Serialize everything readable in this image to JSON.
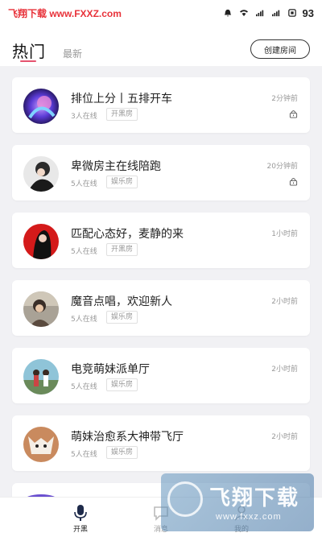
{
  "status_bar": {
    "watermark": "飞翔下载 www.FXXZ.com",
    "battery": "93"
  },
  "header": {
    "tab_hot": "热门",
    "tab_new": "最新",
    "create_button": "创建房间"
  },
  "rooms": [
    {
      "name": "排位上分丨五排开车",
      "online": "3人在线",
      "tag": "开黑房",
      "time": "2分钟前",
      "locked": true
    },
    {
      "name": "卑微房主在线陪跑",
      "online": "5人在线",
      "tag": "娱乐房",
      "time": "20分钟前",
      "locked": true
    },
    {
      "name": "匹配心态好，麦静的来",
      "online": "5人在线",
      "tag": "开黑房",
      "time": "1小时前",
      "locked": false
    },
    {
      "name": "魔音点唱，欢迎新人",
      "online": "5人在线",
      "tag": "娱乐房",
      "time": "2小时前",
      "locked": false
    },
    {
      "name": "电竞萌妹派单厅",
      "online": "5人在线",
      "tag": "娱乐房",
      "time": "2小时前",
      "locked": false
    },
    {
      "name": "萌妹治愈系大神带飞厅",
      "online": "5人在线",
      "tag": "娱乐房",
      "time": "2小时前",
      "locked": false
    }
  ],
  "bottom_nav": {
    "item1": "开黑",
    "item2": "消息",
    "item3": "我的"
  },
  "watermark_bottom": {
    "title": "飞翔下载",
    "url": "www.fxxz.com"
  },
  "colors": {
    "accent": "#e5536f",
    "background": "#f1f1f4",
    "watermark_red": "#e8323a"
  }
}
